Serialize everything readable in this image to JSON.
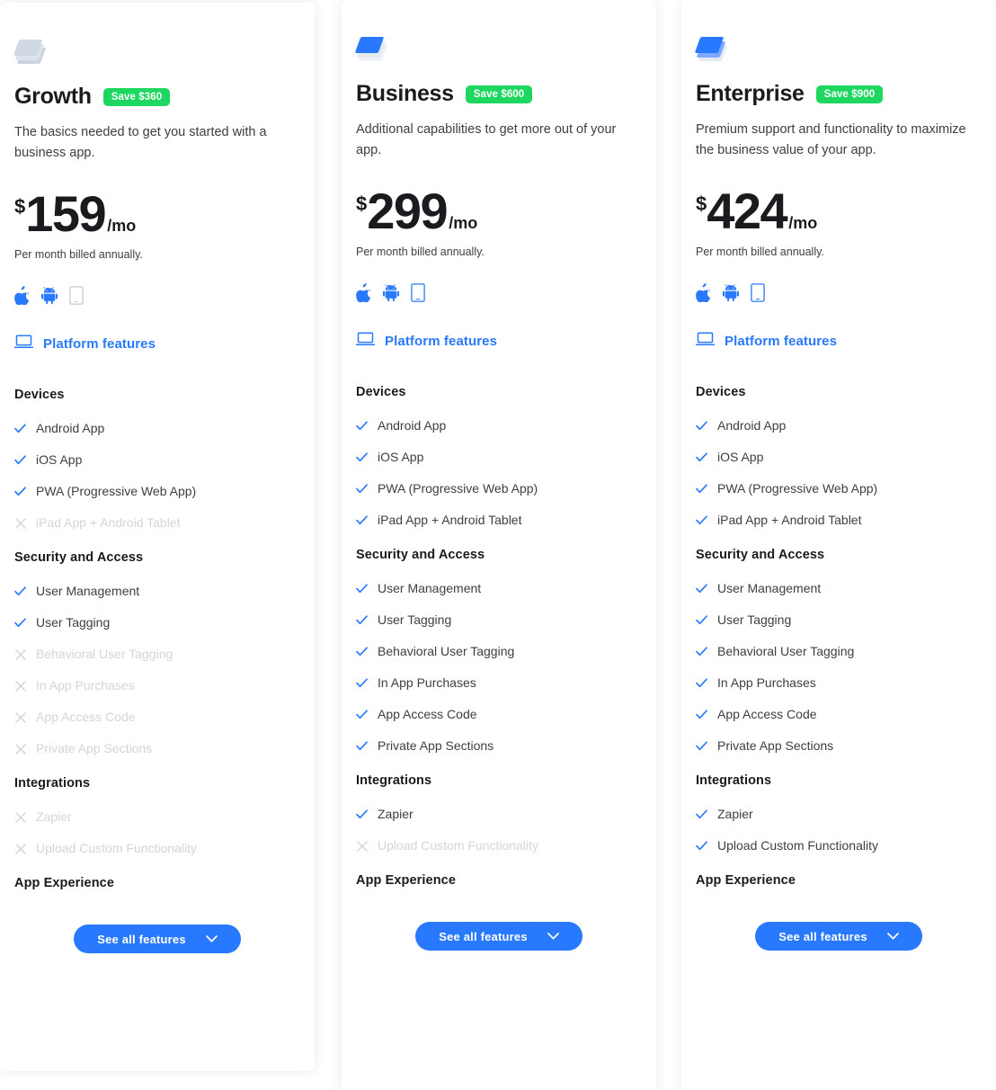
{
  "page": {
    "background": "#ffffff",
    "accent_blue": "#2979ff",
    "badge_green": "#1ed760",
    "disabled_gray": "#d2d5d9"
  },
  "plans": [
    {
      "logo_icon": "stacked-sheets-icon",
      "logo_style": "gray",
      "name": "Growth",
      "save_badge": "Save $360",
      "description": "The basics needed to get you started with a business app.",
      "currency": "$",
      "amount": "159",
      "per": "/mo",
      "billing_note": "Per month billed annually.",
      "devices": [
        {
          "icon": "apple-icon",
          "enabled": true
        },
        {
          "icon": "android-icon",
          "enabled": true
        },
        {
          "icon": "tablet-icon",
          "enabled": false
        }
      ],
      "platform_link": {
        "icon": "laptop-icon",
        "label": "Platform features"
      },
      "sections": [
        {
          "title": "Devices",
          "items": [
            {
              "label": "Android App",
              "included": true
            },
            {
              "label": "iOS App",
              "included": true
            },
            {
              "label": "PWA (Progressive Web App)",
              "included": true
            },
            {
              "label": "iPad App + Android Tablet",
              "included": false
            }
          ]
        },
        {
          "title": "Security and Access",
          "items": [
            {
              "label": "User Management",
              "included": true
            },
            {
              "label": "User Tagging",
              "included": true
            },
            {
              "label": "Behavioral User Tagging",
              "included": false
            },
            {
              "label": "In App Purchases",
              "included": false
            },
            {
              "label": "App Access Code",
              "included": false
            },
            {
              "label": "Private App Sections",
              "included": false
            }
          ]
        },
        {
          "title": "Integrations",
          "items": [
            {
              "label": "Zapier",
              "included": false
            },
            {
              "label": "Upload Custom Functionality",
              "included": false
            }
          ]
        },
        {
          "title": "App Experience",
          "items": []
        }
      ],
      "cta": {
        "label": "See all features",
        "icon": "chevron-down-icon"
      }
    },
    {
      "logo_icon": "stacked-sheets-icon",
      "logo_style": "blue",
      "name": "Business",
      "save_badge": "Save $600",
      "description": "Additional capabilities to get more out of your app.",
      "currency": "$",
      "amount": "299",
      "per": "/mo",
      "billing_note": "Per month billed annually.",
      "devices": [
        {
          "icon": "apple-icon",
          "enabled": true
        },
        {
          "icon": "android-icon",
          "enabled": true
        },
        {
          "icon": "tablet-icon",
          "enabled": true
        }
      ],
      "platform_link": {
        "icon": "laptop-icon",
        "label": "Platform features"
      },
      "sections": [
        {
          "title": "Devices",
          "items": [
            {
              "label": "Android App",
              "included": true
            },
            {
              "label": "iOS App",
              "included": true
            },
            {
              "label": "PWA (Progressive Web App)",
              "included": true
            },
            {
              "label": "iPad App + Android Tablet",
              "included": true
            }
          ]
        },
        {
          "title": "Security and Access",
          "items": [
            {
              "label": "User Management",
              "included": true
            },
            {
              "label": "User Tagging",
              "included": true
            },
            {
              "label": "Behavioral User Tagging",
              "included": true
            },
            {
              "label": "In App Purchases",
              "included": true
            },
            {
              "label": "App Access Code",
              "included": true
            },
            {
              "label": "Private App Sections",
              "included": true
            }
          ]
        },
        {
          "title": "Integrations",
          "items": [
            {
              "label": "Zapier",
              "included": true
            },
            {
              "label": "Upload Custom Functionality",
              "included": false
            }
          ]
        },
        {
          "title": "App Experience",
          "items": []
        }
      ],
      "cta": {
        "label": "See all features",
        "icon": "chevron-down-icon"
      }
    },
    {
      "logo_icon": "stacked-sheets-icon",
      "logo_style": "blue3",
      "name": "Enterprise",
      "save_badge": "Save $900",
      "description": "Premium support and functionality to maximize the business value of your app.",
      "currency": "$",
      "amount": "424",
      "per": "/mo",
      "billing_note": "Per month billed annually.",
      "devices": [
        {
          "icon": "apple-icon",
          "enabled": true
        },
        {
          "icon": "android-icon",
          "enabled": true
        },
        {
          "icon": "tablet-icon",
          "enabled": true
        }
      ],
      "platform_link": {
        "icon": "laptop-icon",
        "label": "Platform features"
      },
      "sections": [
        {
          "title": "Devices",
          "items": [
            {
              "label": "Android App",
              "included": true
            },
            {
              "label": "iOS App",
              "included": true
            },
            {
              "label": "PWA (Progressive Web App)",
              "included": true
            },
            {
              "label": "iPad App + Android Tablet",
              "included": true
            }
          ]
        },
        {
          "title": "Security and Access",
          "items": [
            {
              "label": "User Management",
              "included": true
            },
            {
              "label": "User Tagging",
              "included": true
            },
            {
              "label": "Behavioral User Tagging",
              "included": true
            },
            {
              "label": "In App Purchases",
              "included": true
            },
            {
              "label": "App Access Code",
              "included": true
            },
            {
              "label": "Private App Sections",
              "included": true
            }
          ]
        },
        {
          "title": "Integrations",
          "items": [
            {
              "label": "Zapier",
              "included": true
            },
            {
              "label": "Upload Custom Functionality",
              "included": true
            }
          ]
        },
        {
          "title": "App Experience",
          "items": []
        }
      ],
      "cta": {
        "label": "See all features",
        "icon": "chevron-down-icon"
      }
    }
  ]
}
